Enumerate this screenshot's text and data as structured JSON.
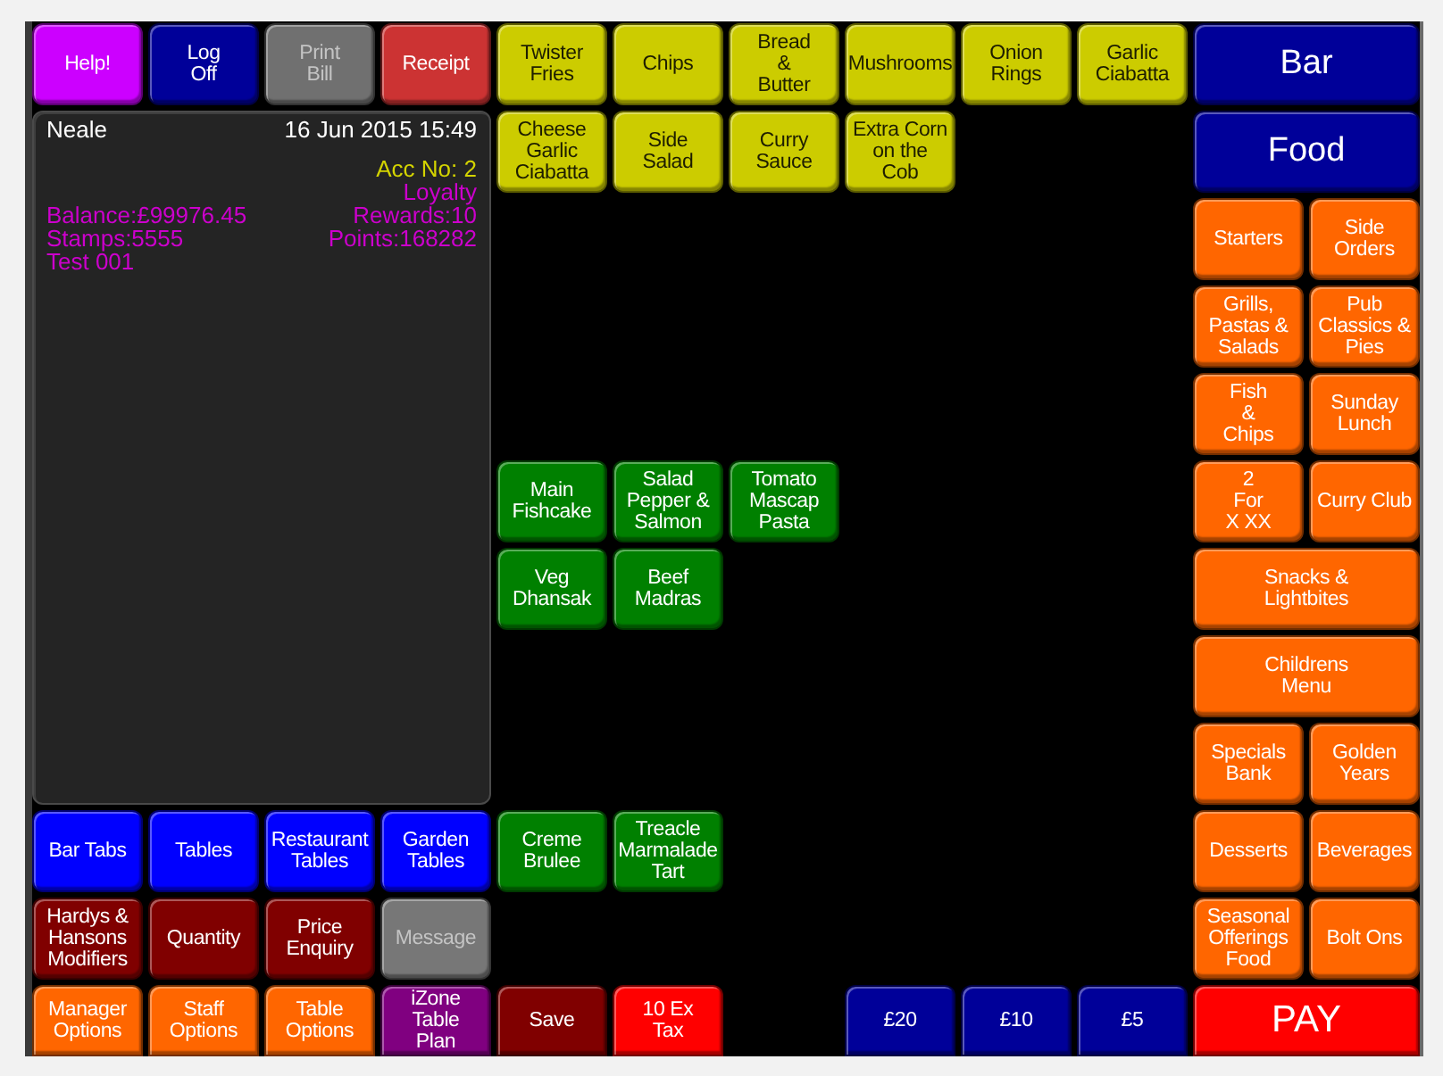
{
  "function_buttons": [
    {
      "label": "Help!",
      "color": "#cc00ff",
      "disabled": false
    },
    {
      "label": "Log\nOff",
      "color": "#000099",
      "disabled": false
    },
    {
      "label": "Print\nBill",
      "color": "#707070",
      "disabled": true
    },
    {
      "label": "Receipt",
      "color": "#cc3333",
      "disabled": false
    }
  ],
  "receipt": {
    "operator": "Neale",
    "timestamp": "16 Jun 2015 15:49",
    "account": "Acc No: 2",
    "loyalty": "Loyalty",
    "balance": "Balance:£99976.45",
    "rewards": "Rewards:10",
    "stamps": "Stamps:5555",
    "points": "Points:168282",
    "customer": "Test 001"
  },
  "table_buttons": [
    "Bar Tabs",
    "Tables",
    "Restaurant\nTables",
    "Garden\nTables"
  ],
  "modifier_buttons": [
    {
      "label": "Hardys &\nHansons\nModifiers",
      "color": "#800000",
      "disabled": false
    },
    {
      "label": "Quantity",
      "color": "#800000",
      "disabled": false
    },
    {
      "label": "Price\nEnquiry",
      "color": "#800000",
      "disabled": false
    },
    {
      "label": "Message",
      "color": "#777777",
      "disabled": true
    }
  ],
  "option_buttons": [
    {
      "label": "Manager\nOptions",
      "color": "#ff6600"
    },
    {
      "label": "Staff\nOptions",
      "color": "#ff6600"
    },
    {
      "label": "Table\nOptions",
      "color": "#ff6600"
    },
    {
      "label": "iZone\nTable\nPlan",
      "color": "#800080"
    }
  ],
  "product_groups": [
    {
      "color": "#cccc00",
      "rows": [
        [
          "Twister\nFries",
          "Chips",
          "Bread\n&\nButter",
          "Mushrooms",
          "Onion\nRings",
          "Garlic\nCiabatta"
        ],
        [
          "Cheese\nGarlic\nCiabatta",
          "Side\nSalad",
          "Curry\nSauce",
          "Extra Corn\non the\nCob"
        ]
      ]
    },
    {
      "color": "#008000",
      "rows": [
        [
          "Main\nFishcake",
          "Salad\nPepper &\nSalmon",
          "Tomato\nMascap\nPasta"
        ],
        [
          "Veg\nDhansak",
          "Beef\nMadras"
        ]
      ]
    },
    {
      "color": "#008000",
      "rows": [
        [
          "Creme\nBrulee",
          "Treacle\nMarmalade\nTart"
        ]
      ]
    }
  ],
  "action_buttons": [
    {
      "label": "Save",
      "color": "#800000"
    },
    {
      "label": "10 Ex\nTax",
      "color": "#ff0000"
    }
  ],
  "cash_buttons": [
    "£20",
    "£10",
    "£5"
  ],
  "category_buttons": [
    "Bar",
    "Food"
  ],
  "departments": [
    {
      "label": "Starters",
      "kind": "normal"
    },
    {
      "label": "Side\nOrders",
      "kind": "normal"
    },
    {
      "label": "Grills,\nPastas &\nSalads",
      "kind": "normal"
    },
    {
      "label": "Pub\nClassics &\nPies",
      "kind": "normal"
    },
    {
      "label": "Fish\n&\nChips",
      "kind": "normal"
    },
    {
      "label": "Sunday\nLunch",
      "kind": "normal"
    },
    {
      "label": "2\nFor\nX XX",
      "kind": "normal"
    },
    {
      "label": "Curry Club",
      "kind": "normal"
    },
    {
      "label": "Snacks &\nLightbites",
      "kind": "wide"
    },
    {
      "label": "Childrens\nMenu",
      "kind": "wide"
    },
    {
      "label": "Specials\nBank",
      "kind": "normal"
    },
    {
      "label": "Golden\nYears",
      "kind": "normal"
    },
    {
      "label": "Desserts",
      "kind": "normal"
    },
    {
      "label": "Beverages",
      "kind": "normal"
    },
    {
      "label": "Seasonal\nOfferings\nFood",
      "kind": "normal"
    },
    {
      "label": "Bolt Ons",
      "kind": "normal"
    }
  ],
  "pay_button": "PAY"
}
